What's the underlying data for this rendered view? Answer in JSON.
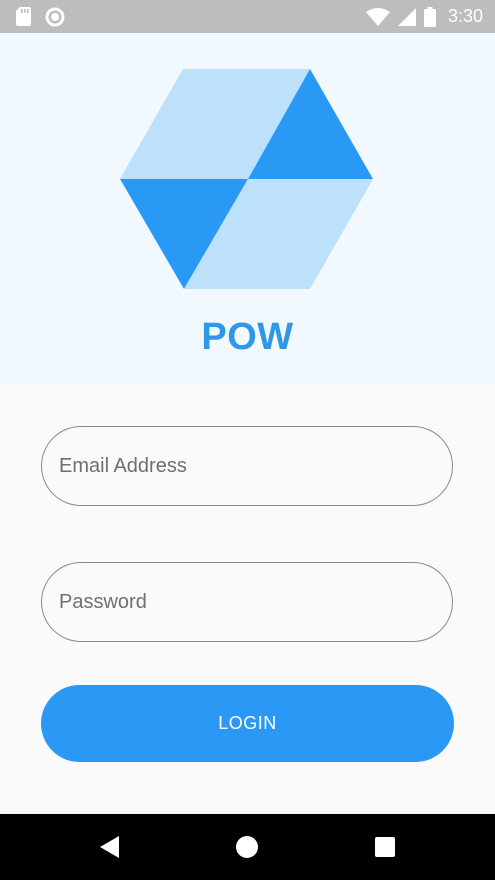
{
  "status_bar": {
    "time": "3:30",
    "icons": [
      "sd-card-icon",
      "sync-circle-icon",
      "wifi-icon",
      "signal-icon",
      "battery-icon"
    ]
  },
  "header": {
    "logo_icon": "hexagon-cube-logo-icon",
    "title": "POW",
    "colors": {
      "light": "#bde0fb",
      "dark": "#2a99f5",
      "title": "#2f97e8",
      "background": "#f1f8fe"
    }
  },
  "form": {
    "email_placeholder": "Email Address",
    "password_placeholder": "Password",
    "login_label": "LOGIN",
    "accent": "#2b98f5"
  },
  "nav_bar": {
    "buttons": [
      "back-icon",
      "home-icon",
      "recents-icon"
    ]
  }
}
